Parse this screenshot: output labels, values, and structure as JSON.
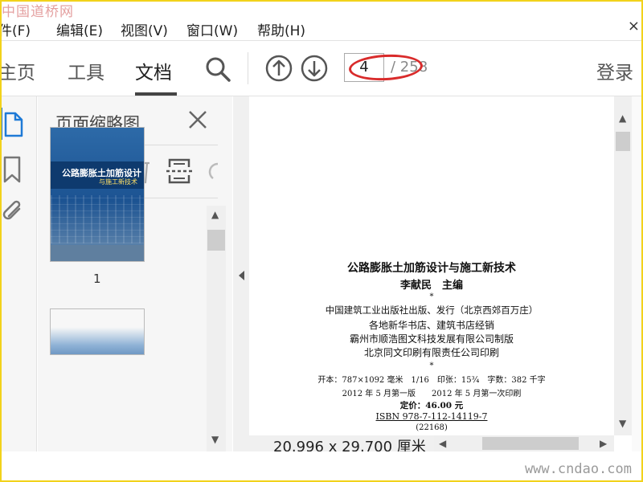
{
  "watermark": {
    "top": "中国道桥网",
    "bottom": "www.cndao.com"
  },
  "menu": {
    "items": [
      "文件(F)",
      "编辑(E)",
      "视图(V)",
      "窗口(W)",
      "帮助(H)"
    ],
    "visible_first": "件(F)",
    "close": "×"
  },
  "toolbar": {
    "tabs": [
      "主页",
      "工具",
      "文档"
    ],
    "visible_first_tab": "主页",
    "active_tab": "文档",
    "page_current": "4",
    "page_total": "/ 258",
    "login": "登录"
  },
  "panel": {
    "title": "页面缩略图",
    "thumbnails": [
      {
        "label": "1",
        "title": "公路膨胀土加筋设计",
        "subtitle": "与施工新技术"
      }
    ]
  },
  "document": {
    "title": "公路膨胀土加筋设计与施工新技术",
    "editor": "李献民　主编",
    "star1": "*",
    "publisher": "中国建筑工业出版社出版、发行（北京西郊百万庄）",
    "distributor": "各地新华书店、建筑书店经销",
    "typesetter": "霸州市顺浩图文科技发展有限公司制版",
    "printer": "北京同文印刷有限责任公司印刷",
    "star2": "*",
    "specs": "开本：787×1092 毫米　1/16　印张：15¾　字数：382 千字",
    "edition": "2012 年 5 月第一版　　2012 年 5 月第一次印刷",
    "price": "定价：46.00 元",
    "isbn": "ISBN 978-7-112-14119-7",
    "code": "(22168)"
  },
  "status": {
    "page_size": "20.996 x 29.700 厘米"
  },
  "colors": {
    "accent": "#1f7ad6",
    "annotation": "#d92b2b",
    "frame": "#f2d21b"
  }
}
